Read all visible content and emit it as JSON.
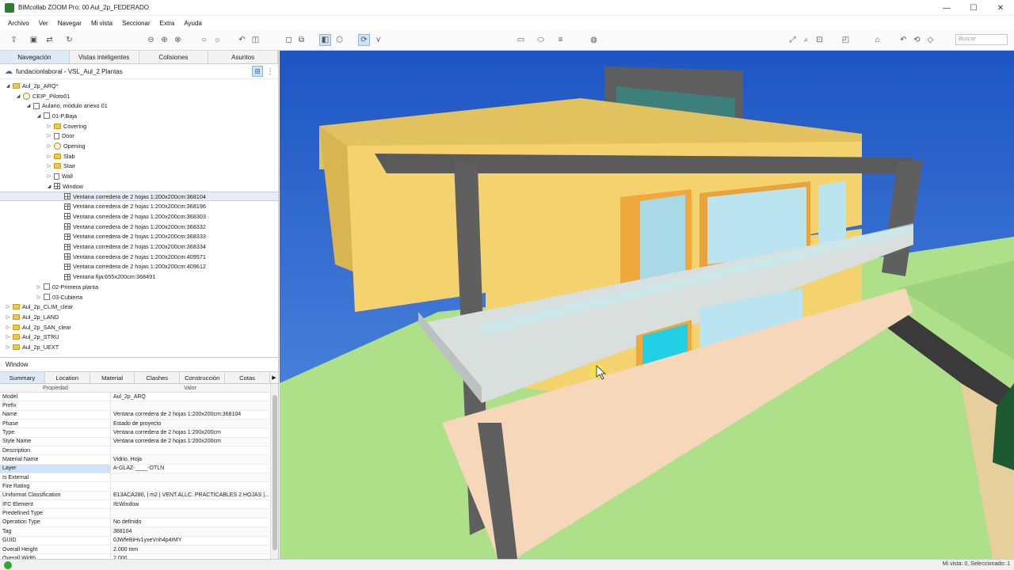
{
  "window": {
    "title": "BIMcollab ZOOM Pro: 00 Aul_2p_FEDERADO",
    "minimize": "—",
    "maximize": "☐",
    "close": "✕"
  },
  "menu": [
    "Archivo",
    "Ver",
    "Navegar",
    "Mi vista",
    "Seccionar",
    "Extra",
    "Ayuda"
  ],
  "search": {
    "placeholder": "Buscar"
  },
  "tabs": [
    "Navegación",
    "Vistas inteligentes",
    "Colisiones",
    "Asuntos"
  ],
  "tree_header": "fundacionlaboral - VSL_Aul_2 Plantas",
  "tree": [
    {
      "label": "Aul_2p_ARQ*",
      "level": 0,
      "icon": "folder",
      "arrow": "◢"
    },
    {
      "label": "CEIP_Piloto01",
      "level": 1,
      "icon": "site",
      "arrow": "◢"
    },
    {
      "label": "Aulario, módulo anexo 01",
      "level": 2,
      "icon": "bldg",
      "arrow": "◢"
    },
    {
      "label": "01-P.Baja",
      "level": 3,
      "icon": "bldg",
      "arrow": "◢"
    },
    {
      "label": "Covering",
      "level": 4,
      "icon": "folder",
      "arrow": "▷"
    },
    {
      "label": "Door",
      "level": 4,
      "icon": "page",
      "arrow": "▷"
    },
    {
      "label": "Opening",
      "level": 4,
      "icon": "site",
      "arrow": "▷"
    },
    {
      "label": "Slab",
      "level": 4,
      "icon": "folder",
      "arrow": "▷"
    },
    {
      "label": "Stair",
      "level": 4,
      "icon": "folder",
      "arrow": "▷"
    },
    {
      "label": "Wall",
      "level": 4,
      "icon": "page",
      "arrow": "▷"
    },
    {
      "label": "Window",
      "level": 4,
      "icon": "grid",
      "arrow": "◢"
    },
    {
      "label": "Ventana corredera de 2 hojas 1:200x200cm:368104",
      "level": 5,
      "icon": "grid",
      "arrow": "",
      "selected": true
    },
    {
      "label": "Ventana corredera de 2 hojas 1:200x200cm:368196",
      "level": 5,
      "icon": "grid",
      "arrow": ""
    },
    {
      "label": "Ventana corredera de 2 hojas 1:200x200cm:368303",
      "level": 5,
      "icon": "grid",
      "arrow": ""
    },
    {
      "label": "Ventana corredera de 2 hojas 1:200x200cm:368332",
      "level": 5,
      "icon": "grid",
      "arrow": ""
    },
    {
      "label": "Ventana corredera de 2 hojas 1:200x200cm:368333",
      "level": 5,
      "icon": "grid",
      "arrow": ""
    },
    {
      "label": "Ventana corredera de 2 hojas 1:200x200cm:368334",
      "level": 5,
      "icon": "grid",
      "arrow": ""
    },
    {
      "label": "Ventana corredera de 2 hojas 1:200x200cm:409571",
      "level": 5,
      "icon": "grid",
      "arrow": ""
    },
    {
      "label": "Ventana corredera de 2 hojas 1:200x200cm:409612",
      "level": 5,
      "icon": "grid",
      "arrow": ""
    },
    {
      "label": "Ventana fija:655x200cm:368491",
      "level": 5,
      "icon": "grid",
      "arrow": ""
    },
    {
      "label": "02-Primera planta",
      "level": 3,
      "icon": "bldg",
      "arrow": "▷"
    },
    {
      "label": "03-Cubierta",
      "level": 3,
      "icon": "bldg",
      "arrow": "▷"
    },
    {
      "label": "Aul_2p_CLIM_clear",
      "level": 0,
      "icon": "folder",
      "arrow": "▷"
    },
    {
      "label": "Aul_2p_LAND",
      "level": 0,
      "icon": "folder",
      "arrow": "▷"
    },
    {
      "label": "Aul_2p_SAN_clear",
      "level": 0,
      "icon": "folder",
      "arrow": "▷"
    },
    {
      "label": "Aul_2p_STRU",
      "level": 0,
      "icon": "folder",
      "arrow": "▷"
    },
    {
      "label": "Aul_2p_UEXT",
      "level": 0,
      "icon": "folder",
      "arrow": "▷"
    }
  ],
  "section_label": "Window",
  "prop_tabs": [
    "Summary",
    "Location",
    "Material",
    "Clashes",
    "Construcción",
    "Cotas"
  ],
  "prop_tabs_more": "▶",
  "props_header": {
    "key": "Propiedad",
    "value": "Valor"
  },
  "properties": [
    {
      "k": "Model",
      "v": "Aul_2p_ARQ"
    },
    {
      "k": "Prefix",
      "v": ""
    },
    {
      "k": "Name",
      "v": "Ventana corredera de 2 hojas 1:200x200cm:368104"
    },
    {
      "k": "Phase",
      "v": "Estado de proyecto"
    },
    {
      "k": "Type",
      "v": "Ventana corredera de 2 hojas 1:200x200cm"
    },
    {
      "k": "Style Name",
      "v": "Ventana corredera de 2 hojas 1:200x200cm"
    },
    {
      "k": "Description",
      "v": ""
    },
    {
      "k": "Material Name",
      "v": "Vidrio, Hoja"
    },
    {
      "k": "Layer",
      "v": "A-GLAZ-____-OTLN",
      "hl": true
    },
    {
      "k": "Is External",
      "v": ""
    },
    {
      "k": "Fire Rating",
      "v": ""
    },
    {
      "k": "Uniformat Classification",
      "v": "E13ACA280, | m2 | VENT.ALLC. PRACTICABLES 2 HOJAS |..."
    },
    {
      "k": "IFC Element",
      "v": "IfcWindow"
    },
    {
      "k": "Predefined Type",
      "v": ""
    },
    {
      "k": "Operation Type",
      "v": "No definido"
    },
    {
      "k": "Tag",
      "v": "368104"
    },
    {
      "k": "GUID",
      "v": "0JWfeBiHv1yxeVnh4p4rMY"
    },
    {
      "k": "Overall Height",
      "v": "2.000 mm"
    },
    {
      "k": "Overall Width",
      "v": "2.000"
    }
  ],
  "status": "Mi vista: 0, Seleccionado: 1",
  "colors": {
    "accent": "#3a6ea5",
    "tab_active": "#dde9f6",
    "facade": "#f4d36f",
    "frame": "#626262",
    "selected_glass": "#22d0e6"
  }
}
